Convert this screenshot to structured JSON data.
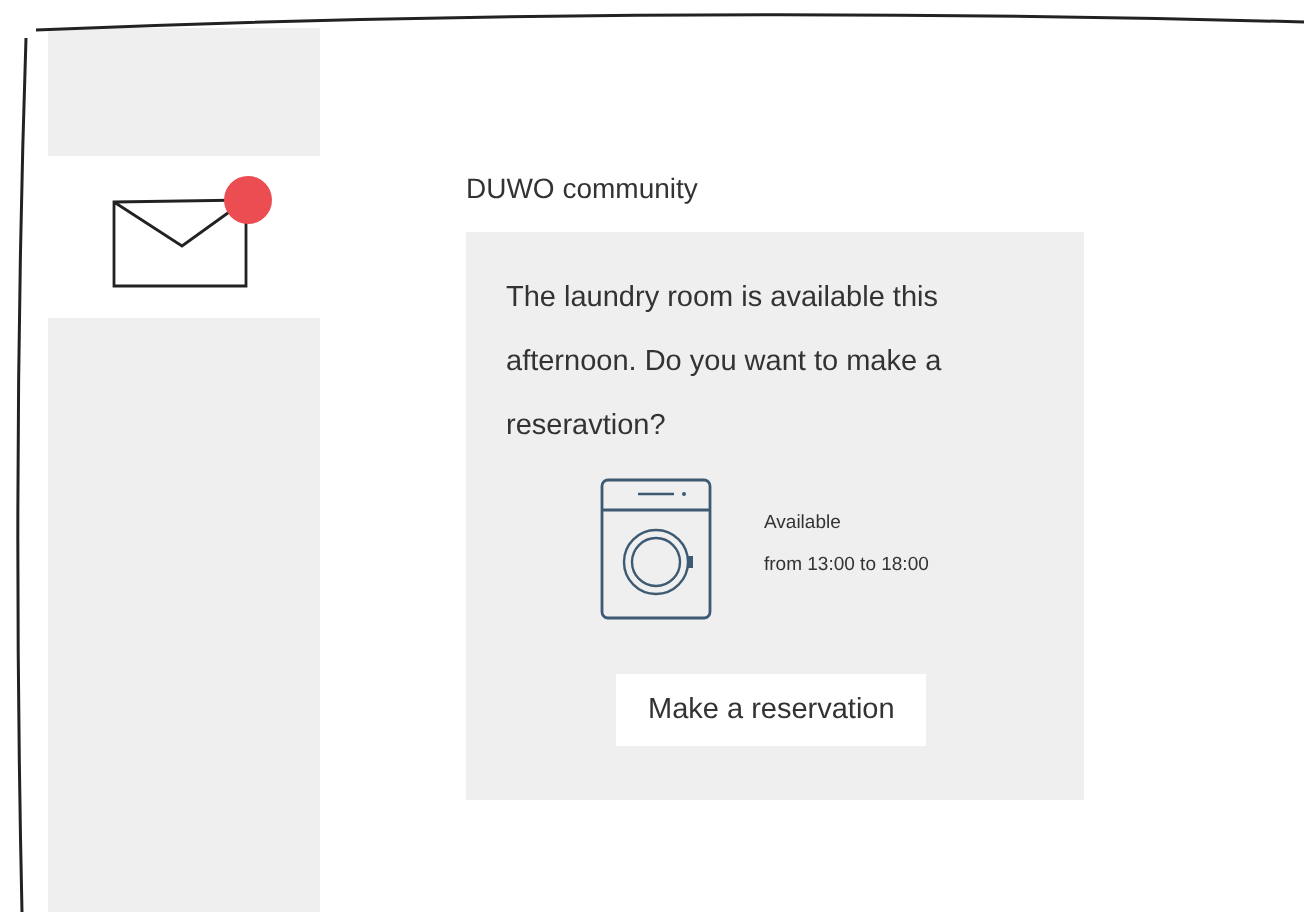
{
  "sidebar": {
    "items": [
      {
        "kind": "mail",
        "selected": true,
        "unread": true
      }
    ]
  },
  "message": {
    "sender": "DUWO community",
    "body": "The laundry room is available this afternoon. Do you want to make a reseravtion?",
    "availability": [
      "Available",
      "from 13:00 to 18:00"
    ],
    "button": "Make a reservation"
  }
}
